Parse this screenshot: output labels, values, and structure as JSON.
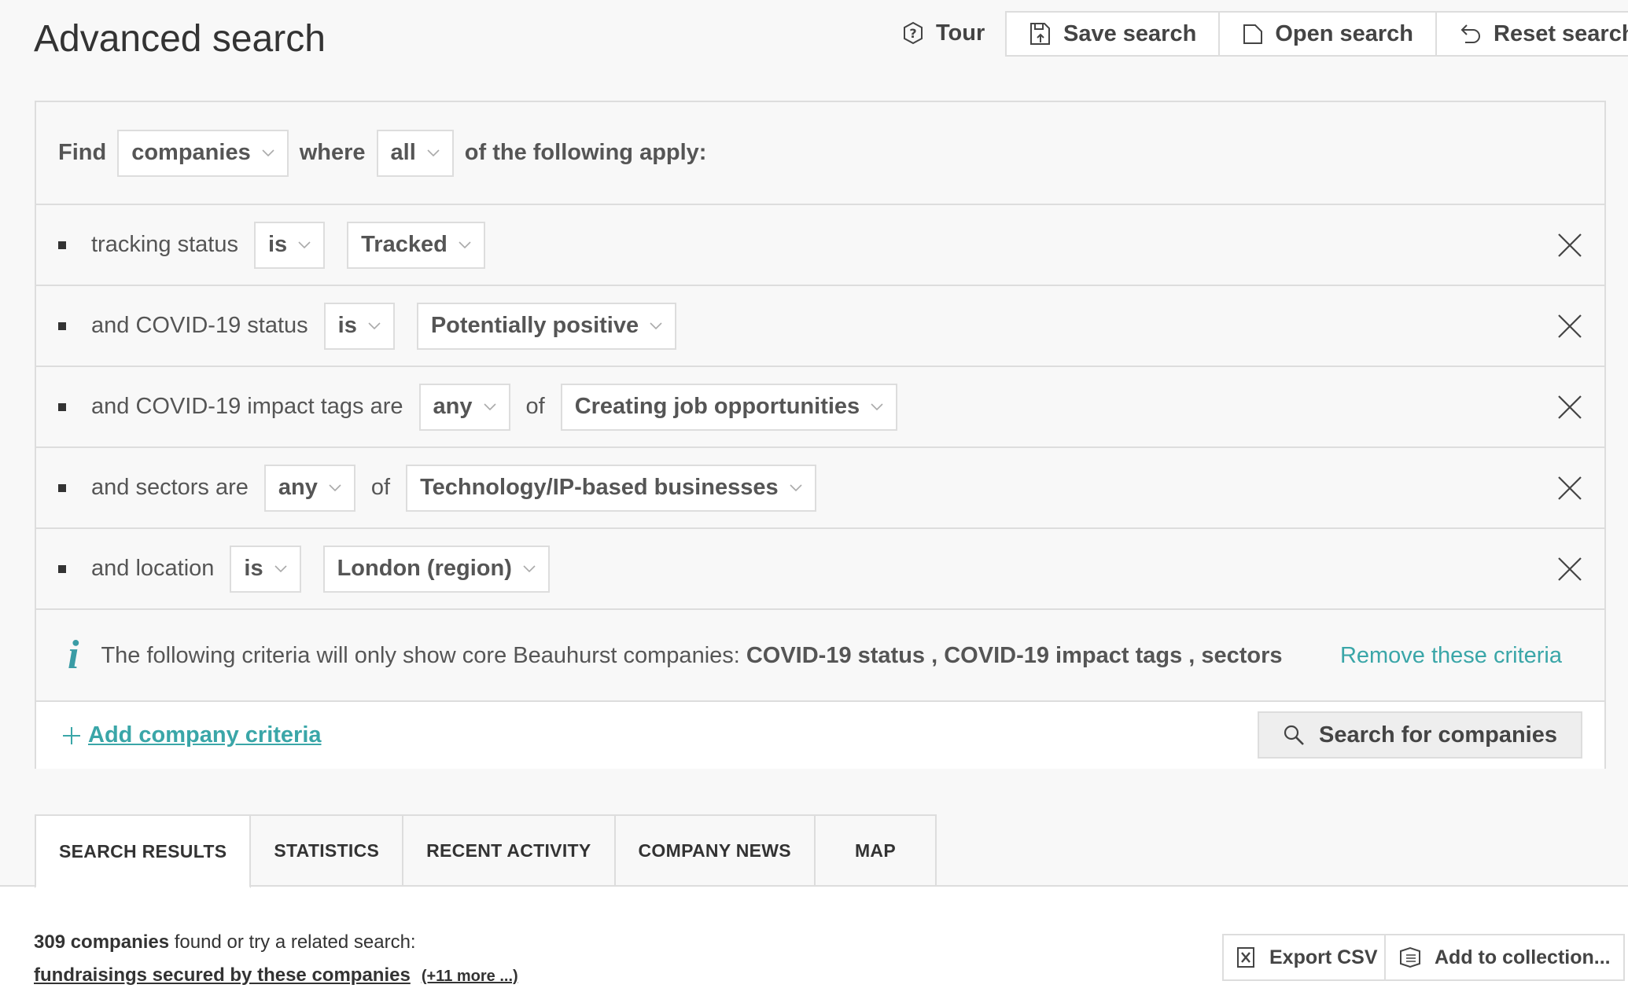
{
  "header": {
    "title": "Advanced search",
    "tour_label": "Tour",
    "save_label": "Save search",
    "open_label": "Open search",
    "reset_label": "Reset search"
  },
  "find": {
    "find_label": "Find",
    "entity_value": "companies",
    "where_label": "where",
    "match_value": "all",
    "suffix": "of the following apply:"
  },
  "criteria": [
    {
      "label": "tracking status",
      "operator": "is",
      "value": "Tracked"
    },
    {
      "label": "and COVID-19 status",
      "operator": "is",
      "value": "Potentially positive"
    },
    {
      "label": "and COVID-19 impact tags are",
      "operator": "any",
      "of_label": "of",
      "value": "Creating job opportunities"
    },
    {
      "label": "and sectors are",
      "operator": "any",
      "of_label": "of",
      "value": "Technology/IP-based businesses"
    },
    {
      "label": "and location",
      "operator": "is",
      "value": "London (region)"
    }
  ],
  "info": {
    "icon_glyph": "i",
    "text": "The following criteria will only show core Beauhurst companies:",
    "fields": "COVID-19 status , COVID-19 impact tags , sectors",
    "remove_label": "Remove these criteria"
  },
  "actions": {
    "add_label": "Add company criteria",
    "search_label": "Search for companies"
  },
  "tabs": [
    {
      "label": "SEARCH RESULTS",
      "active": true
    },
    {
      "label": "STATISTICS",
      "active": false
    },
    {
      "label": "RECENT ACTIVITY",
      "active": false
    },
    {
      "label": "COMPANY NEWS",
      "active": false
    },
    {
      "label": "MAP",
      "active": false
    }
  ],
  "results": {
    "count_text": "309 companies",
    "suffix": " found or try a related search:",
    "related_link": "fundraisings secured by these companies",
    "more_link": "(+11 more ...)",
    "export_label": "Export CSV",
    "collection_label": "Add to collection..."
  },
  "colors": {
    "accent": "#3aa6a8",
    "border": "#dddddd",
    "background": "#f8f8f8"
  }
}
